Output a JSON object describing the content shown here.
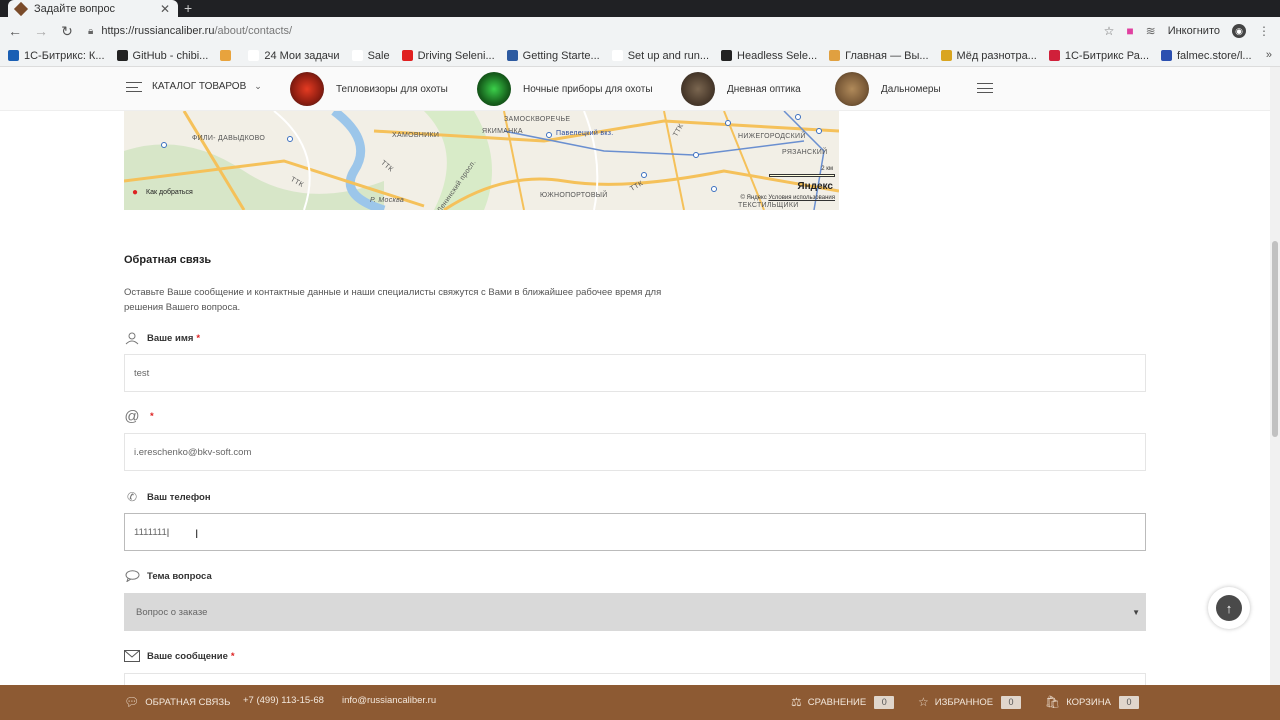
{
  "browser": {
    "tab_title": "Задайте вопрос",
    "new_tab": "+",
    "url_domain": "https://russiancaliber.ru",
    "url_path": "/about/contacts/",
    "incognito_label": "Инкогнито",
    "bookmarks": [
      {
        "label": "1С-Битрикс: К...",
        "color": "#1a5fb4"
      },
      {
        "label": "GitHub - chibi...",
        "color": "#222222"
      },
      {
        "label": "",
        "color": "#e8a33d"
      },
      {
        "label": "24  Мои задачи",
        "color": "#ffffff"
      },
      {
        "label": "Sale",
        "color": "#ffffff"
      },
      {
        "label": "Driving Seleni...",
        "color": "#e02020"
      },
      {
        "label": "Getting Starte...",
        "color": "#2d5aa0"
      },
      {
        "label": "Set up and run...",
        "color": "#ffffff"
      },
      {
        "label": "Headless Sele...",
        "color": "#222222"
      },
      {
        "label": "Главная — Вы...",
        "color": "#e0a040"
      },
      {
        "label": "Мёд разнотра...",
        "color": "#d9a520"
      },
      {
        "label": "1С-Битрикс Ра...",
        "color": "#d0203a"
      },
      {
        "label": "falmec.store/l...",
        "color": "#2b4fb0"
      }
    ],
    "bookmarks_more": "»"
  },
  "nav": {
    "catalog_label": "КАТАЛОГ ТОВАРОВ",
    "categories": [
      {
        "label": "Тепловизоры для охоты",
        "color": "#b52a1c"
      },
      {
        "label": "Ночные приборы для охоты",
        "color": "#1f7a28"
      },
      {
        "label": "Дневная оптика",
        "color": "#5a4a3a"
      },
      {
        "label": "Дальномеры",
        "color": "#8a6a44"
      }
    ]
  },
  "map": {
    "labels": [
      "ФИЛИ-\nДАВЫДКОВО",
      "ХАМОВНИКИ",
      "ЯКИМАНКА",
      "ЗАМОСКВОРЕЧЬЕ",
      "Павелецкий вкз.",
      "НИЖЕГОРОДСКИЙ",
      "РЯЗАНСКИЙ",
      "ЮЖНОПОРТОВЫЙ",
      "ТЕКСТИЛЬЩИКИ",
      "Ленинский просп.",
      "Р. Москва",
      "ТТК",
      "ТТК",
      "ТТК",
      "ТТК"
    ],
    "route_label": "Как добраться",
    "yandex": "Яндекс",
    "copyright": "© Яндекс",
    "terms": "Условия использования",
    "scale": "2 км"
  },
  "form": {
    "title": "Обратная связь",
    "description": "Оставьте Ваше сообщение и контактные данные и наши специалисты свяжутся с Вами в ближайшее рабочее время для решения Вашего вопроса.",
    "required_mark": "*",
    "name_label": "Ваше имя",
    "name_value": "test",
    "email_value": "i.ereschenko@bkv-soft.com",
    "phone_label": "Ваш телефон",
    "phone_value": "1111111",
    "topic_label": "Тема вопроса",
    "topic_value": "Вопрос о заказе",
    "message_label": "Ваше сообщение"
  },
  "footer": {
    "feedback": "ОБРАТНАЯ СВЯЗЬ",
    "phone": "+7 (499) 113-15-68",
    "email": "info@russiancaliber.ru",
    "compare": "СРАВНЕНИЕ",
    "compare_count": "0",
    "favorites": "ИЗБРАННОЕ",
    "favorites_count": "0",
    "cart": "КОРЗИНА",
    "cart_count": "0"
  }
}
